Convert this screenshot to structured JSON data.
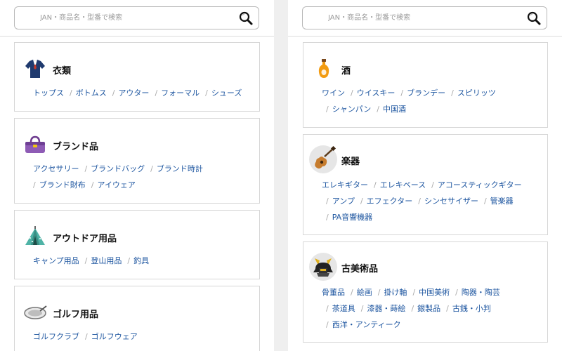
{
  "search": {
    "placeholder": "JAN・商品名・型番で検索"
  },
  "left_categories": [
    {
      "title": "衣類",
      "icon": "shirt-icon",
      "rows": [
        [
          "トップス",
          "ボトムス",
          "アウター",
          "フォーマル",
          "シューズ"
        ]
      ]
    },
    {
      "title": "ブランド品",
      "icon": "handbag-icon",
      "rows": [
        [
          "アクセサリー",
          "ブランドバッグ",
          "ブランド時計"
        ],
        [
          "ブランド財布",
          "アイウェア"
        ]
      ]
    },
    {
      "title": "アウトドア用品",
      "icon": "tent-icon",
      "rows": [
        [
          "キャンプ用品",
          "登山用品",
          "釣具"
        ]
      ]
    },
    {
      "title": "ゴルフ用品",
      "icon": "golf-club-icon",
      "rows": [
        [
          "ゴルフクラブ",
          "ゴルフウェア"
        ]
      ]
    }
  ],
  "right_categories": [
    {
      "title": "酒",
      "icon": "sake-bottle-icon",
      "rows": [
        [
          "ワイン",
          "ウイスキー",
          "ブランデー",
          "スピリッツ"
        ],
        [
          "シャンパン",
          "中国酒"
        ]
      ]
    },
    {
      "title": "楽器",
      "icon": "guitar-icon",
      "rows": [
        [
          "エレキギター",
          "エレキベース",
          "アコースティックギター"
        ],
        [
          "アンプ",
          "エフェクター",
          "シンセサイザー",
          "管楽器"
        ],
        [
          "PA音響機器"
        ]
      ]
    },
    {
      "title": "古美術品",
      "icon": "samurai-helmet-icon",
      "rows": [
        [
          "骨董品",
          "絵画",
          "掛け軸",
          "中国美術",
          "陶器・陶芸"
        ],
        [
          "茶道具",
          "漆器・蒔絵",
          "銀製品",
          "古銭・小判"
        ],
        [
          "西洋・アンティーク"
        ]
      ]
    }
  ]
}
